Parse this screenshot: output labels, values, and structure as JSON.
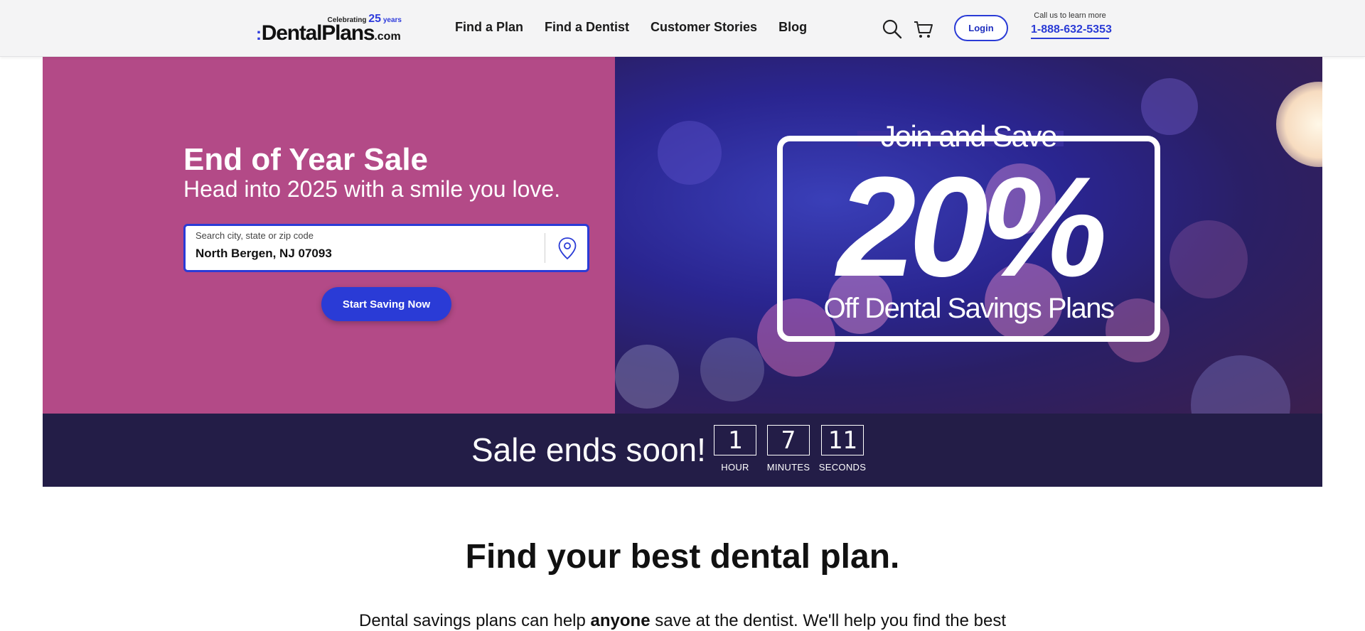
{
  "header": {
    "logo": {
      "celebrating": "Celebrating",
      "years_num": "25",
      "years_word": "years",
      "wordmark": "DentalPlans",
      "tld": ".com"
    },
    "nav": [
      {
        "label": "Find a Plan"
      },
      {
        "label": "Find a Dentist"
      },
      {
        "label": "Customer Stories"
      },
      {
        "label": "Blog"
      }
    ],
    "login_label": "Login",
    "call_text": "Call us to learn more",
    "phone": "1-888-632-5353"
  },
  "hero": {
    "title": "End of Year Sale",
    "subtitle": "Head into 2025 with a smile you love.",
    "search": {
      "label": "Search city, state or zip code",
      "value": "North Bergen, NJ 07093"
    },
    "cta_label": "Start Saving Now",
    "promo": {
      "join": "Join and Save",
      "percent": "20%",
      "off": "Off Dental Savings Plans"
    },
    "bg_color": "#b34a87"
  },
  "countdown": {
    "title": "Sale ends soon!",
    "hour": "1",
    "minutes": "7",
    "seconds": "11",
    "hour_label": "HOUR",
    "minutes_label": "MINUTES",
    "seconds_label": "SECONDS",
    "bg_color": "#231d47"
  },
  "section": {
    "title": "Find your best dental plan.",
    "body_pre": "Dental savings plans can help ",
    "body_bold": "anyone",
    "body_post": " save at the dentist. We'll help you find the best"
  },
  "colors": {
    "accent": "#2a3bd6"
  }
}
